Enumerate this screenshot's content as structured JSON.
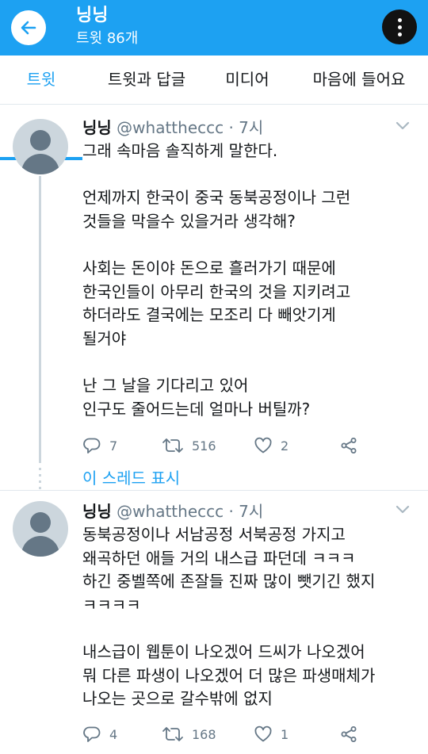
{
  "header": {
    "title": "닝닝",
    "subtitle": "트윗 86개",
    "back_icon": "arrow-left-icon",
    "more_icon": "more-vertical-icon",
    "background": "#1da1f2"
  },
  "tabs": [
    {
      "label": "트윗",
      "active": true
    },
    {
      "label": "트윗과 답글",
      "active": false
    },
    {
      "label": "미디어",
      "active": false
    },
    {
      "label": "마음에 들어요",
      "active": false
    }
  ],
  "tweets": [
    {
      "name": "닝닝",
      "meta": "@whattheccc · 7시",
      "text": "그래 속마음 솔직하게 말한다.\n\n언제까지 한국이 중국 동북공정이나 그런\n것들을 막을수 있을거라 생각해?\n\n사회는 돈이야 돈으로 흘러가기 때문에\n한국인들이 아무리 한국의 것을 지키려고\n하더라도 결국에는 모조리 다 빼앗기게\n될거야\n\n난 그 날을 기다리고 있어\n인구도 줄어드는데 얼마나 버틸까?",
      "replies": "7",
      "retweets": "516",
      "likes": "2"
    },
    {
      "name": "닝닝",
      "meta": "@whattheccc · 7시",
      "text": "동북공정이나 서남공정 서북공정 가지고\n왜곡하던 애들 거의 내스급 파던데 ㅋㅋㅋ\n하긴 중벨쪽에 존잘들 진짜 많이 뺏기긴 했지\nㅋㅋㅋㅋ\n\n내스급이 웹툰이 나오겠어 드씨가 나오겠어\n뭐 다른 파생이 나오겠어 더 많은 파생매체가\n나오는 곳으로 갈수밖에 없지",
      "replies": "4",
      "retweets": "168",
      "likes": "1"
    }
  ],
  "show_thread": "이 스레드 표시",
  "icons": {
    "reply": "reply-icon",
    "retweet": "retweet-icon",
    "like": "heart-icon",
    "share": "share-icon",
    "caret": "chevron-down-icon",
    "avatar": "default-avatar-icon"
  },
  "colors": {
    "accent": "#1da1f2",
    "text": "#14171a",
    "secondary": "#657786"
  }
}
